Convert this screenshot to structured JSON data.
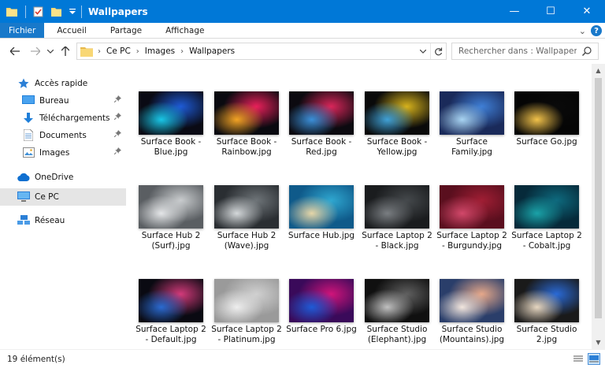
{
  "window": {
    "title": "Wallpapers",
    "minimize_glyph": "—",
    "maximize_glyph": "☐",
    "close_glyph": "✕"
  },
  "ribbon": {
    "tabs": [
      "Fichier",
      "Accueil",
      "Partage",
      "Affichage"
    ],
    "expand_glyph": "⌄",
    "help_glyph": "?"
  },
  "address": {
    "crumbs": [
      "Ce PC",
      "Images",
      "Wallpapers"
    ],
    "search_placeholder": "Rechercher dans : Wallpapers"
  },
  "nav": {
    "quick_access": "Accès rapide",
    "pinned": [
      {
        "label": "Bureau",
        "icon": "desktop-icon"
      },
      {
        "label": "Téléchargements",
        "icon": "download-icon"
      },
      {
        "label": "Documents",
        "icon": "documents-icon"
      },
      {
        "label": "Images",
        "icon": "pictures-icon"
      }
    ],
    "onedrive": "OneDrive",
    "this_pc": "Ce PC",
    "network": "Réseau"
  },
  "files": [
    {
      "name": "Surface Book - Blue.jpg",
      "thumb": [
        "#0a0a14",
        "#1e5bd6",
        "#19c6e6"
      ]
    },
    {
      "name": "Surface Book - Rainbow.jpg",
      "thumb": [
        "#0a0a10",
        "#e8205a",
        "#f2a324"
      ]
    },
    {
      "name": "Surface Book - Red.jpg",
      "thumb": [
        "#0c0a10",
        "#d9265a",
        "#3a8fd8"
      ]
    },
    {
      "name": "Surface Book - Yellow.jpg",
      "thumb": [
        "#0a0a0a",
        "#d6b21c",
        "#3fa0d6"
      ]
    },
    {
      "name": "Surface Family.jpg",
      "thumb": [
        "#1a2a5a",
        "#3f7fd6",
        "#a8d4f2"
      ]
    },
    {
      "name": "Surface Go.jpg",
      "thumb": [
        "#050505",
        "#0a0a0a",
        "#f2c24a"
      ]
    },
    {
      "name": "Surface Hub 2 (Surf).jpg",
      "thumb": [
        "#5a5e62",
        "#c9ccce",
        "#e4e6e8"
      ]
    },
    {
      "name": "Surface Hub 2 (Wave).jpg",
      "thumb": [
        "#2a2e32",
        "#6e7478",
        "#d4d8da"
      ]
    },
    {
      "name": "Surface Hub.jpg",
      "thumb": [
        "#0f5a8a",
        "#2fa7d0",
        "#e6d6a8"
      ]
    },
    {
      "name": "Surface Laptop 2 - Black.jpg",
      "thumb": [
        "#1a1c1e",
        "#45494c",
        "#7a7e82"
      ]
    },
    {
      "name": "Surface Laptop 2 - Burgundy.jpg",
      "thumb": [
        "#5a0f1e",
        "#a01e34",
        "#d2486a"
      ]
    },
    {
      "name": "Surface Laptop 2 - Cobalt.jpg",
      "thumb": [
        "#062a3a",
        "#0e6a7e",
        "#1aa2a8"
      ]
    },
    {
      "name": "Surface Laptop 2 - Default.jpg",
      "thumb": [
        "#0a0a12",
        "#d23a7a",
        "#2a6ad0"
      ]
    },
    {
      "name": "Surface Laptop 2 - Platinum.jpg",
      "thumb": [
        "#9a9a9a",
        "#d0d0d0",
        "#eeeeee"
      ]
    },
    {
      "name": "Surface Pro 6.jpg",
      "thumb": [
        "#3a0a5a",
        "#d0147a",
        "#1e5ad6"
      ]
    },
    {
      "name": "Surface Studio (Elephant).jpg",
      "thumb": [
        "#101010",
        "#606060",
        "#c0c0c0"
      ]
    },
    {
      "name": "Surface Studio (Mountains).jpg",
      "thumb": [
        "#2a3e6a",
        "#e6a88a",
        "#f2e6de"
      ]
    },
    {
      "name": "Surface Studio 2.jpg",
      "thumb": [
        "#1a1a1a",
        "#2a6ad6",
        "#e6d6c0"
      ]
    }
  ],
  "status": {
    "count": "19 élément(s)"
  },
  "colors": {
    "accent": "#0078d7",
    "file_tab": "#1979ca",
    "selected_nav": "#e5e5e5"
  }
}
